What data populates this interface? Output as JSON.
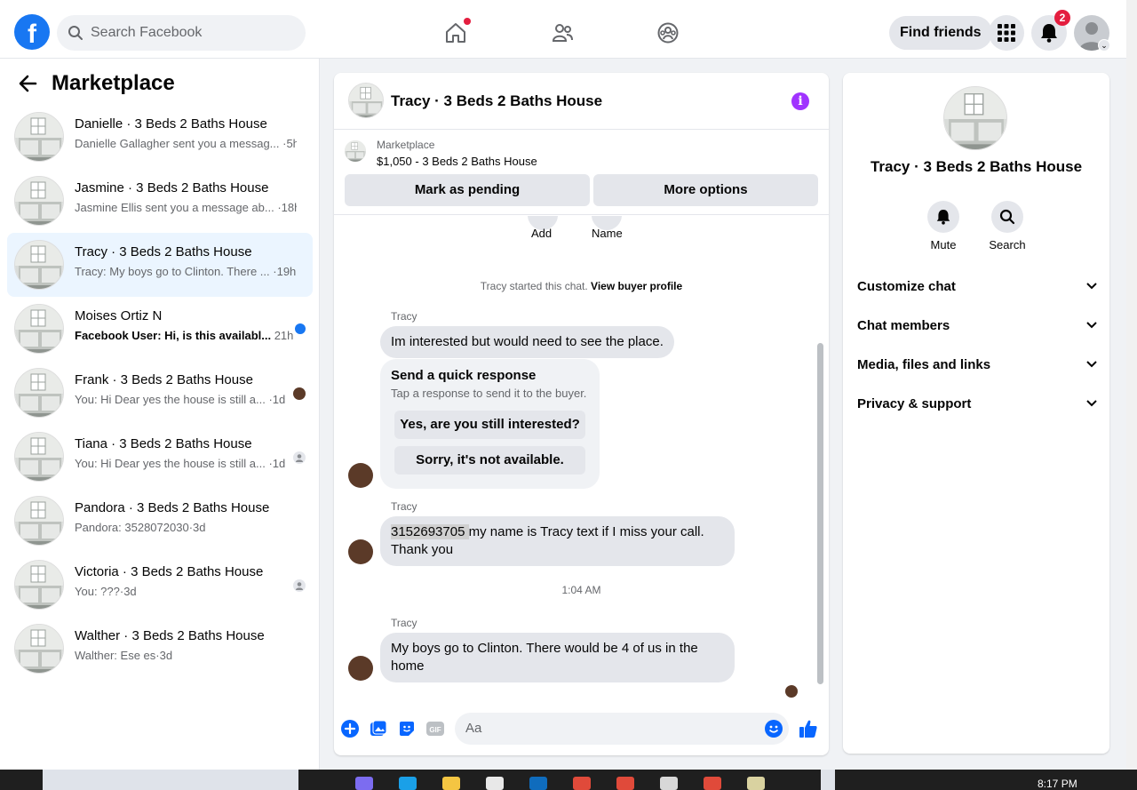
{
  "topbar": {
    "logo": "f",
    "search_placeholder": "Search Facebook",
    "find_friends": "Find friends",
    "notifications_count": "2"
  },
  "sidebar": {
    "title": "Marketplace",
    "conversations": [
      {
        "title": "Danielle · 3 Beds 2 Baths House",
        "preview": "Danielle Gallagher sent you a messag...",
        "time": " ·5h",
        "unread": false,
        "active": false,
        "indicator": "none"
      },
      {
        "title": "Jasmine · 3 Beds 2 Baths House",
        "preview": "Jasmine Ellis sent you a message ab...",
        "time": " ·18h",
        "unread": false,
        "active": false,
        "indicator": "none"
      },
      {
        "title": "Tracy · 3 Beds 2 Baths House",
        "preview": "Tracy: My boys go to Clinton. There ...",
        "time": " ·19h",
        "unread": false,
        "active": true,
        "indicator": "none"
      },
      {
        "title": "Moises Ortiz N",
        "preview": "Facebook User: Hi, is this availabl...",
        "time": " 21h",
        "unread": true,
        "active": false,
        "indicator": "unread-dot"
      },
      {
        "title": "Frank · 3 Beds 2 Baths House",
        "preview": "You: Hi Dear yes the house is still a...",
        "time": " ·1d",
        "unread": false,
        "active": false,
        "indicator": "seen-photo"
      },
      {
        "title": "Tiana · 3 Beds 2 Baths House",
        "preview": "You: Hi Dear yes the house is still a...",
        "time": " ·1d",
        "unread": false,
        "active": false,
        "indicator": "seen-default"
      },
      {
        "title": "Pandora · 3 Beds 2 Baths House",
        "preview": "Pandora: 3528072030",
        "time": "·3d",
        "unread": false,
        "active": false,
        "indicator": "none"
      },
      {
        "title": "Victoria · 3 Beds 2 Baths House",
        "preview": "You: ???",
        "time": "·3d",
        "unread": false,
        "active": false,
        "indicator": "seen-default"
      },
      {
        "title": "Walther · 3 Beds 2 Baths House",
        "preview": "Walther: Ese es",
        "time": "·3d",
        "unread": false,
        "active": false,
        "indicator": "none"
      }
    ]
  },
  "chat": {
    "title": "Tracy · 3 Beds 2 Baths House",
    "marketplace_label": "Marketplace",
    "listing": "$1,050 - 3 Beds 2 Baths House",
    "mark_pending": "Mark as pending",
    "more_options": "More options",
    "add_label": "Add",
    "name_label": "Name",
    "started_text": "Tracy started this chat. ",
    "buyer_profile_link": "View buyer profile",
    "sender": "Tracy",
    "msg1": "Im interested but would need to see the place.",
    "quick_title": "Send a quick response",
    "quick_sub": "Tap a response to send it to the buyer.",
    "quick_opt1": "Yes, are you still interested?",
    "quick_opt2": "Sorry, it's not available.",
    "msg2_phone": "3152693705 ",
    "msg2_rest": "my name is Tracy  text if I miss your call.",
    "msg2_line2": "Thank you",
    "timestamp": "1:04 AM",
    "msg3_line1": "My boys go to Clinton. There would be 4 of us in the",
    "msg3_line2": "home",
    "composer_placeholder": "Aa"
  },
  "info_panel": {
    "title": "Tracy · 3 Beds 2 Baths House",
    "mute": "Mute",
    "search": "Search",
    "rows": [
      "Customize chat",
      "Chat members",
      "Media, files and links",
      "Privacy & support"
    ]
  },
  "taskbar": {
    "clock": "8:17 PM"
  },
  "colors": {
    "brand": "#1877f2",
    "active_row": "#ebf5ff",
    "badge": "#e41e3f",
    "info_accent": "#a033ff"
  }
}
